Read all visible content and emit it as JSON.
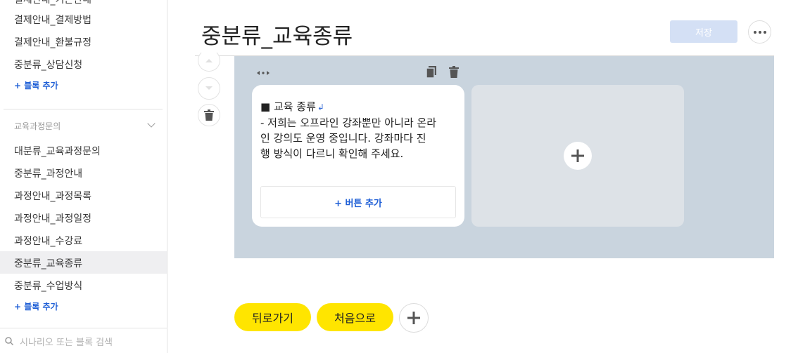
{
  "sidebar": {
    "top_items": [
      "결제안내_결제방법",
      "결제안내_환불규정",
      "중분류_상담신청"
    ],
    "add_block_label": "+ 블록 추가",
    "group_label": "교육과정문의",
    "group_items": [
      "대분류_교육과정문의",
      "중분류_과정안내",
      "과정안내_과정목록",
      "과정안내_과정일정",
      "과정안내_수강료",
      "중분류_교육종류",
      "중분류_수업방식"
    ],
    "selected_item": "중분류_교육종류",
    "add_block_label_2": "+ 블록 추가",
    "search_placeholder": "시나리오 또는 블록 검색"
  },
  "header": {
    "title": "중분류_교육종류",
    "save_label": "저장"
  },
  "card": {
    "heading": "■ 교육 종류",
    "enter_symbol": "↲",
    "body_lines": [
      "- 저희는 오프라인 강좌뿐만 아니라 온라",
      "인 강의도 운영 중입니다. 강좌마다 진",
      "행 방식이 다르니 확인해 주세요."
    ],
    "add_button_label": "+ 버튼 추가"
  },
  "quick_replies": [
    "뒤로가기",
    "처음으로"
  ],
  "colors": {
    "accent_blue": "#1f5fd6",
    "panel_bg": "#c9d4de",
    "quick_reply_yellow": "#ffe500",
    "save_disabled": "#d4e0f5"
  }
}
